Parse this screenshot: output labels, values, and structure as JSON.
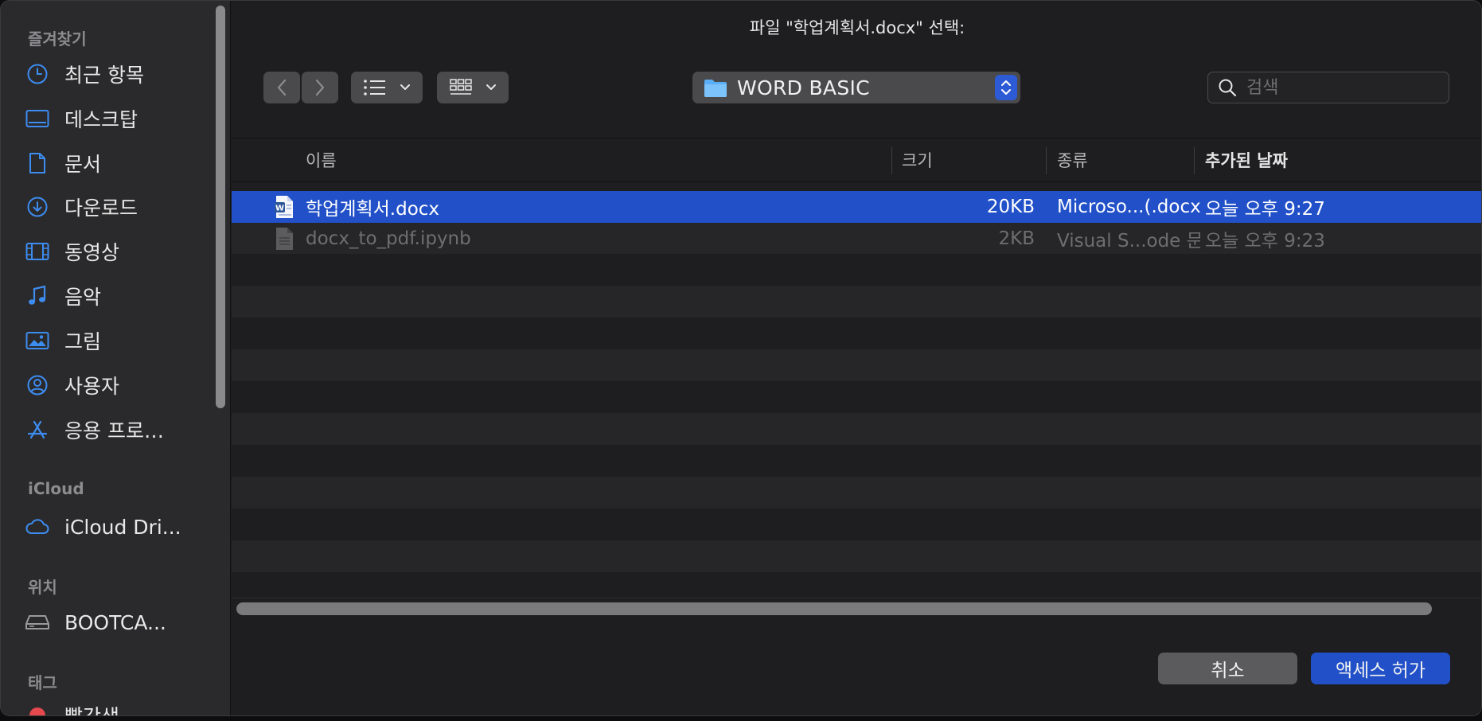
{
  "dialog": {
    "title": "파일 \"학업계획서.docx\" 선택:"
  },
  "sidebar": {
    "sections": [
      {
        "header": "즐겨찾기",
        "items": [
          {
            "label": "최근 항목",
            "icon": "clock-icon"
          },
          {
            "label": "데스크탑",
            "icon": "desktop-icon"
          },
          {
            "label": "문서",
            "icon": "document-icon"
          },
          {
            "label": "다운로드",
            "icon": "download-icon"
          },
          {
            "label": "동영상",
            "icon": "film-icon"
          },
          {
            "label": "음악",
            "icon": "music-note-icon"
          },
          {
            "label": "그림",
            "icon": "photo-icon"
          },
          {
            "label": "사용자",
            "icon": "user-circle-icon"
          },
          {
            "label": "응용 프로…",
            "icon": "app-store-icon"
          }
        ]
      },
      {
        "header": "iCloud",
        "items": [
          {
            "label": "iCloud Dri...",
            "icon": "cloud-icon"
          }
        ]
      },
      {
        "header": "위치",
        "items": [
          {
            "label": "BOOTCA...",
            "icon": "drive-icon"
          }
        ]
      },
      {
        "header": "태그",
        "items": [
          {
            "label": "빨간색",
            "icon": "tag-dot-icon",
            "color": "#e5484d"
          }
        ]
      }
    ]
  },
  "toolbar": {
    "back_icon": "chevron-left-icon",
    "forward_icon": "chevron-right-icon",
    "list_view_icon": "list-view-icon",
    "grid_view_icon": "grid-view-icon",
    "location": "WORD BASIC",
    "search_placeholder": "검색"
  },
  "table": {
    "columns": {
      "name": "이름",
      "size": "크기",
      "kind": "종류",
      "date": "추가된 날짜"
    },
    "rows": [
      {
        "name": "학업계획서.docx",
        "size": "20KB",
        "kind": "Microso...(.docx)",
        "date": "오늘 오후 9:27",
        "icon": "word-document-icon",
        "selected": true
      },
      {
        "name": "docx_to_pdf.ipynb",
        "size": "2KB",
        "kind": "Visual S...ode 문서",
        "date": "오늘 오후 9:23",
        "icon": "generic-document-icon",
        "selected": false
      }
    ]
  },
  "footer": {
    "cancel_label": "취소",
    "allow_label": "액세스 허가"
  },
  "colors": {
    "accent": "#2150c8",
    "sidebar_icon": "#3d8cf0",
    "tag_red": "#e5484d"
  }
}
